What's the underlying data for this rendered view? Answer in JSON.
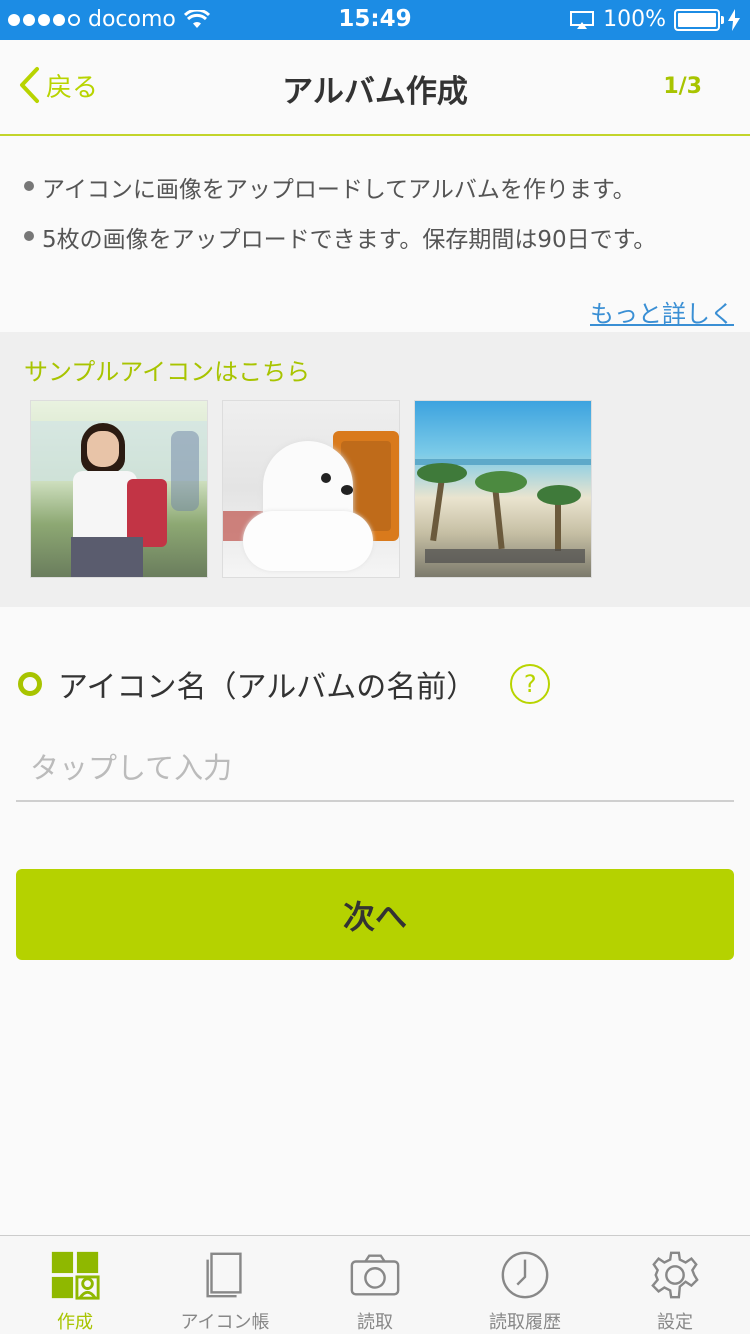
{
  "status_bar": {
    "carrier": "docomo",
    "time": "15:49",
    "battery": "100%"
  },
  "nav": {
    "back_label": "戻る",
    "title": "アルバム作成",
    "step": "1/3"
  },
  "intro": {
    "bullets": [
      "アイコンに画像をアップロードしてアルバムを作ります。",
      "5枚の画像をアップロードできます。保存期間は90日です。"
    ],
    "more_link": "もっと詳しく"
  },
  "sample": {
    "title": "サンプルアイコンはこちら"
  },
  "form": {
    "label": "アイコン名（アルバムの名前）",
    "help_symbol": "?",
    "placeholder": "タップして入力"
  },
  "next_button": "次へ",
  "tabs": [
    {
      "label": "作成",
      "icon": "create-icon",
      "active": true
    },
    {
      "label": "アイコン帳",
      "icon": "icon-book-icon",
      "active": false
    },
    {
      "label": "読取",
      "icon": "camera-icon",
      "active": false
    },
    {
      "label": "読取履歴",
      "icon": "clock-icon",
      "active": false
    },
    {
      "label": "設定",
      "icon": "gear-icon",
      "active": false
    }
  ],
  "colors": {
    "accent": "#b5d200",
    "status_bar": "#1c8ce4",
    "link": "#3a8fd4"
  }
}
